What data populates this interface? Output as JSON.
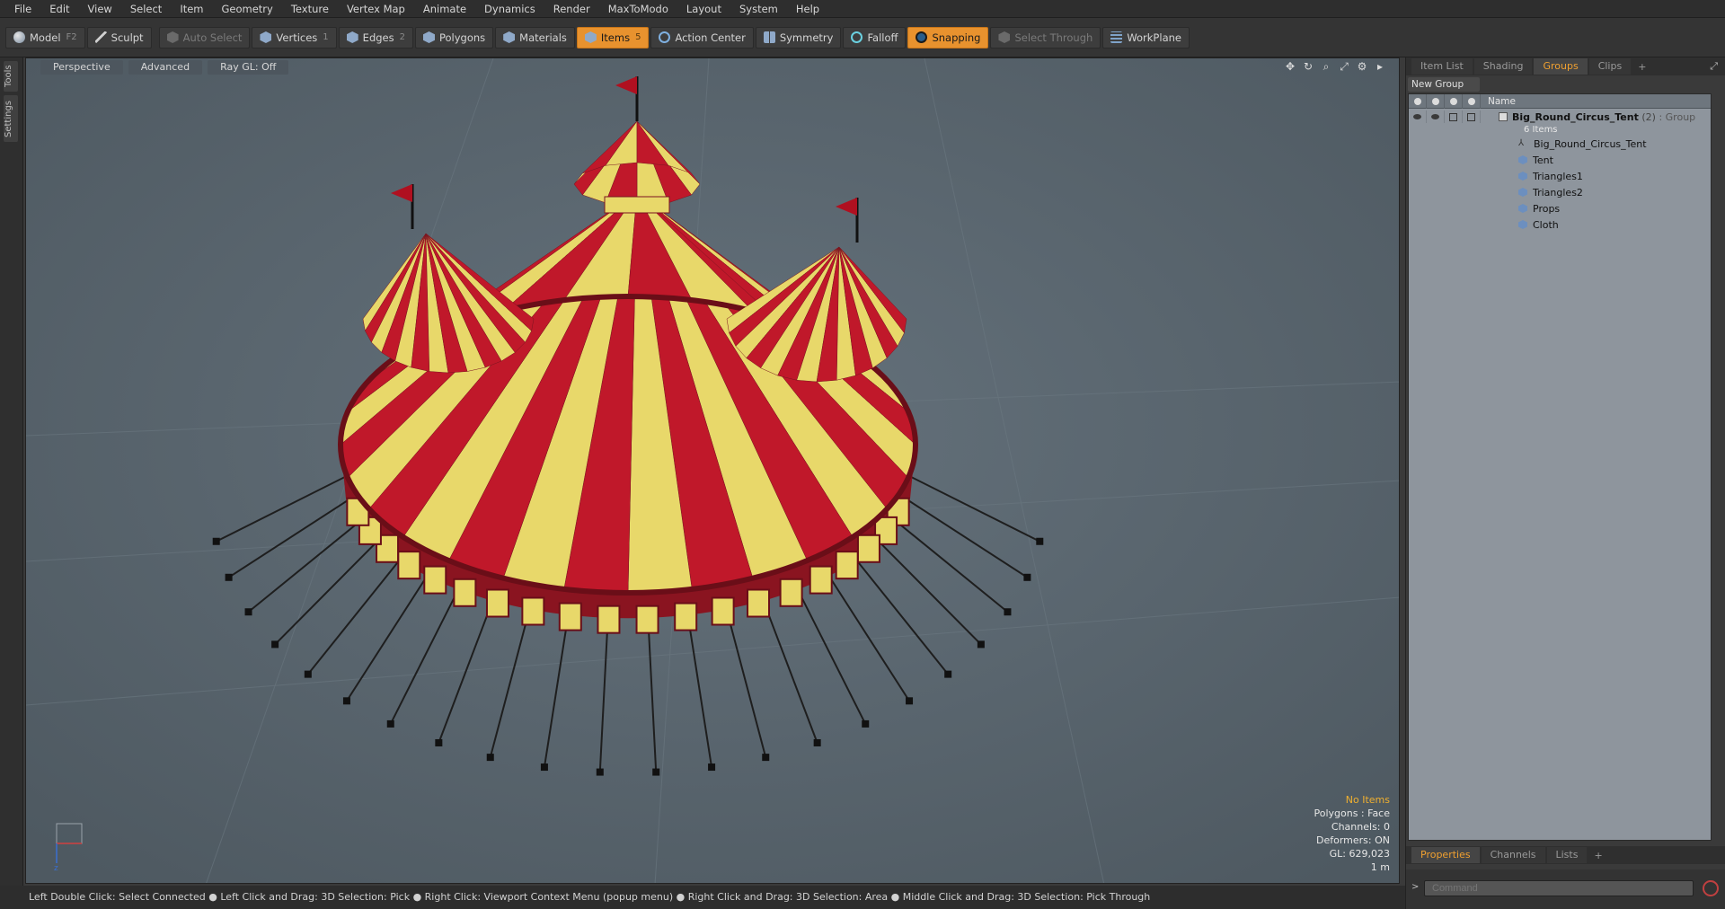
{
  "menu": [
    "File",
    "Edit",
    "View",
    "Select",
    "Item",
    "Geometry",
    "Texture",
    "Vertex Map",
    "Animate",
    "Dynamics",
    "Render",
    "MaxToModo",
    "Layout",
    "System",
    "Help"
  ],
  "toolbar": {
    "model": {
      "label": "Model",
      "key": "F2"
    },
    "sculpt": {
      "label": "Sculpt"
    },
    "auto_select": {
      "label": "Auto Select"
    },
    "vertices": {
      "label": "Vertices",
      "key": "1"
    },
    "edges": {
      "label": "Edges",
      "key": "2"
    },
    "polygons": {
      "label": "Polygons"
    },
    "materials": {
      "label": "Materials"
    },
    "items": {
      "label": "Items",
      "key": "5"
    },
    "action_center": {
      "label": "Action Center"
    },
    "symmetry": {
      "label": "Symmetry"
    },
    "falloff": {
      "label": "Falloff"
    },
    "snapping": {
      "label": "Snapping"
    },
    "select_through": {
      "label": "Select Through"
    },
    "workplane": {
      "label": "WorkPlane"
    },
    "accent_color": "#e8922e"
  },
  "left_tabs": [
    "Tools",
    "Settings"
  ],
  "viewport": {
    "tabs": [
      "Perspective",
      "Advanced",
      "Ray GL: Off"
    ],
    "background": "#5a6670",
    "info": {
      "selection": "No Items",
      "polygons": "Polygons : Face",
      "channels": "Channels: 0",
      "deformers": "Deformers: ON",
      "gl": "GL: 629,023",
      "scale": "1 m"
    },
    "tent_colors": {
      "red": "#c0182a",
      "yellow": "#e8d86a"
    }
  },
  "status": "Left Double Click: Select Connected ● Left Click and Drag: 3D Selection: Pick ● Right Click: Viewport Context Menu (popup menu) ● Right Click and Drag: 3D Selection: Area ● Middle Click and Drag: 3D Selection: Pick Through",
  "right_panel": {
    "tabs": [
      "Item List",
      "Shading",
      "Groups",
      "Clips"
    ],
    "active_tab": "Groups",
    "new_group": "New Group",
    "tree_header": "Name",
    "group": {
      "name": "Big_Round_Circus_Tent",
      "count": "(2)",
      "type": ": Group",
      "items_label": "6 Items"
    },
    "children": [
      "Big_Round_Circus_Tent",
      "Tent",
      "Triangles1",
      "Triangles2",
      "Props",
      "Cloth"
    ],
    "bottom_tabs": [
      "Properties",
      "Channels",
      "Lists"
    ],
    "bottom_active": "Properties",
    "command_placeholder": "Command"
  }
}
